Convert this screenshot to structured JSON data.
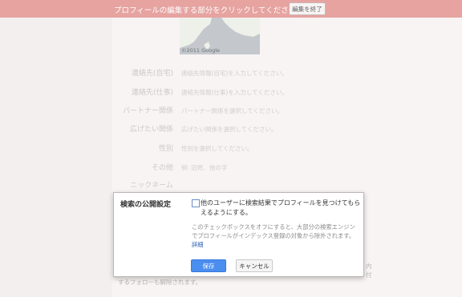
{
  "topbar": {
    "message": "プロフィールの編集する部分をクリックしてください。",
    "end_button": "編集を終了"
  },
  "map": {
    "credit": "©2011 Google"
  },
  "fields": [
    {
      "label": "連絡先(自宅)",
      "value": "連絡先情報(自宅)を入力してください。"
    },
    {
      "label": "連絡先(仕事)",
      "value": "連絡先情報(仕事)を入力してください。"
    },
    {
      "label": "パートナー関係",
      "value": "パートナー関係を選択してください。"
    },
    {
      "label": "広げたい関係",
      "value": "広げたい関係を選択してください。"
    },
    {
      "label": "性別",
      "value": "性別を選択してください。"
    },
    {
      "label": "その他",
      "value": "例: 旧姓、他の字"
    },
    {
      "label": "ニックネーム",
      "value": ""
    }
  ],
  "background_text": {
    "bottom": "するフォローも解除されます。",
    "side_1": "内",
    "side_2": "付"
  },
  "dialog": {
    "title": "検索の公開設定",
    "checkbox_label": "他のユーザーに検索結果でプロフィールを見つけてもらえるようにする。",
    "checkbox_checked": false,
    "help_text": "このチェックボックスをオフにすると、大部分の検索エンジンでプロフィールがインデックス登録の対象から除外されます。",
    "help_link": "詳細",
    "save_label": "保存",
    "cancel_label": "キャンセル"
  }
}
